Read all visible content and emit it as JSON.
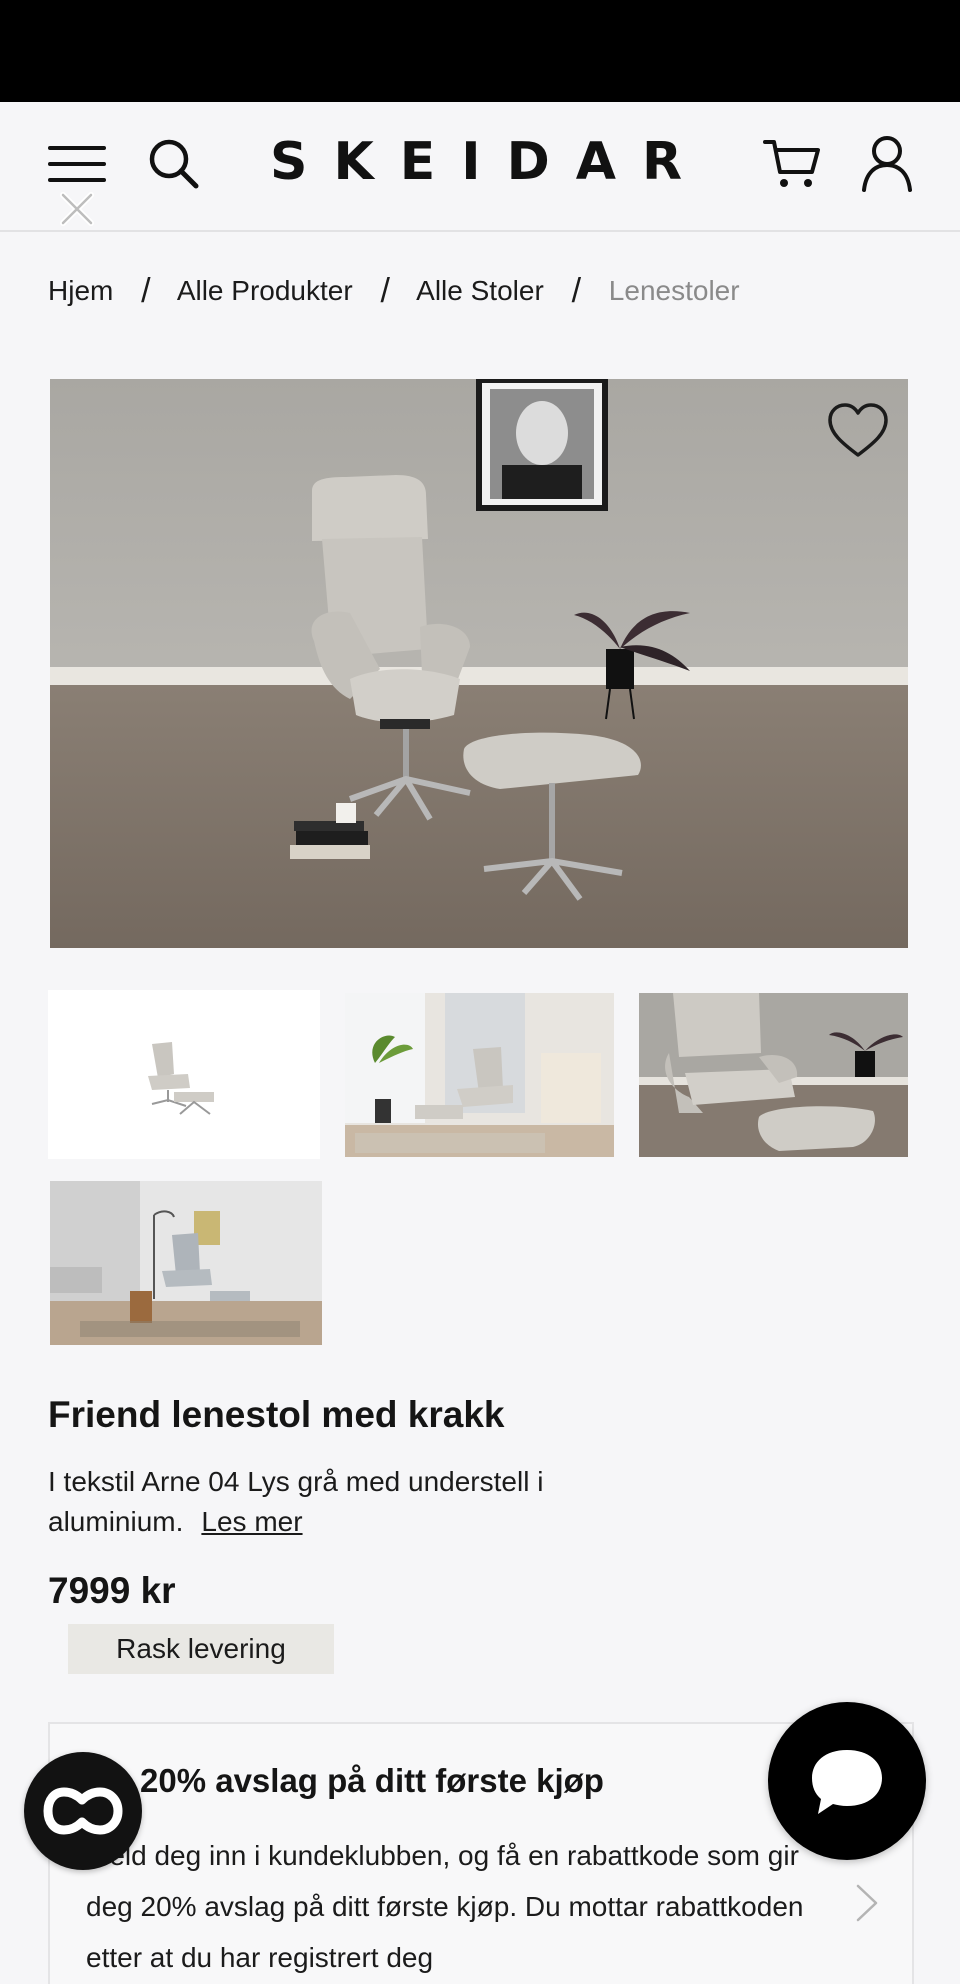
{
  "header": {
    "logo": "SKEIDAR",
    "icons": [
      "menu-icon",
      "close-icon",
      "search-icon",
      "cart-icon",
      "user-icon"
    ]
  },
  "breadcrumb": {
    "items": [
      "Hjem",
      "Alle Produkter",
      "Alle Stoler"
    ],
    "separator": "/",
    "current": "Lenestoler"
  },
  "product": {
    "title": "Friend lenestol med krakk",
    "description": "I tekstil Arne 04 Lys grå med understell i aluminium.",
    "read_more": "Les mer",
    "price": "7999 kr",
    "badge": "Rask levering",
    "gallery_count": 4
  },
  "promo": {
    "title": "20% avslag på ditt første kjøp",
    "text": "Meld deg inn i kundeklubben, og få en rabattkode som gir deg 20% avslag på ditt første kjøp. Du mottar rabattkoden etter at du har registrert deg"
  },
  "floating": {
    "co_label": "CO",
    "chat_icon": "chat-bubble-icon"
  },
  "colors": {
    "background": "#f6f6f8",
    "text": "#1b1b1b",
    "muted": "#8a8a8a",
    "badge_bg": "#e9e8e4",
    "chat_button": "#000000"
  }
}
